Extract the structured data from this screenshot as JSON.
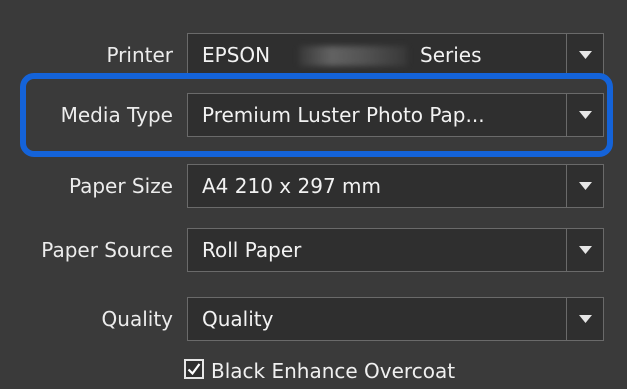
{
  "printer": {
    "label": "Printer",
    "value_prefix": "EPSON",
    "value_suffix": "Series"
  },
  "media_type": {
    "label": "Media Type",
    "value": "Premium Luster Photo Pap..."
  },
  "paper_size": {
    "label": "Paper Size",
    "value": "A4 210 x 297 mm"
  },
  "paper_source": {
    "label": "Paper Source",
    "value": "Roll Paper"
  },
  "quality": {
    "label": "Quality",
    "value": "Quality"
  },
  "black_enhance": {
    "label": "Black Enhance Overcoat",
    "checked": true
  },
  "colors": {
    "panel_bg": "#3a3a3a",
    "combo_bg": "#2f2f2f",
    "highlight": "#1463d9"
  }
}
